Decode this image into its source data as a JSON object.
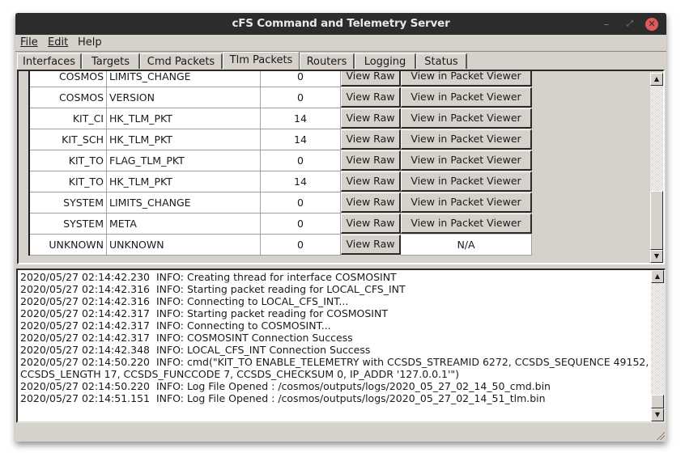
{
  "window": {
    "title": "cFS Command and Telemetry Server",
    "controls": {
      "minimize": "–",
      "maximize": "⤢",
      "close": "✕"
    }
  },
  "menu": [
    "File",
    "Edit",
    "Help"
  ],
  "tabs": [
    {
      "label": "Interfaces",
      "active": false
    },
    {
      "label": "Targets",
      "active": false
    },
    {
      "label": "Cmd Packets",
      "active": false
    },
    {
      "label": "Tlm Packets",
      "active": true
    },
    {
      "label": "Routers",
      "active": false
    },
    {
      "label": "Logging",
      "active": false
    },
    {
      "label": "Status",
      "active": false
    }
  ],
  "tlm_packets": {
    "view_raw_label": "View Raw",
    "view_viewer_label": "View in Packet Viewer",
    "rows": [
      {
        "target": "COSMOS",
        "packet": "LIMITS_CHANGE",
        "count": "0",
        "viewer": "View in Packet Viewer"
      },
      {
        "target": "COSMOS",
        "packet": "VERSION",
        "count": "0",
        "viewer": "View in Packet Viewer"
      },
      {
        "target": "KIT_CI",
        "packet": "HK_TLM_PKT",
        "count": "14",
        "viewer": "View in Packet Viewer"
      },
      {
        "target": "KIT_SCH",
        "packet": "HK_TLM_PKT",
        "count": "14",
        "viewer": "View in Packet Viewer"
      },
      {
        "target": "KIT_TO",
        "packet": "FLAG_TLM_PKT",
        "count": "0",
        "viewer": "View in Packet Viewer"
      },
      {
        "target": "KIT_TO",
        "packet": "HK_TLM_PKT",
        "count": "14",
        "viewer": "View in Packet Viewer"
      },
      {
        "target": "SYSTEM",
        "packet": "LIMITS_CHANGE",
        "count": "0",
        "viewer": "View in Packet Viewer"
      },
      {
        "target": "SYSTEM",
        "packet": "META",
        "count": "0",
        "viewer": "View in Packet Viewer"
      },
      {
        "target": "UNKNOWN",
        "packet": "UNKNOWN",
        "count": "0",
        "viewer": "N/A"
      }
    ]
  },
  "log": [
    "2020/05/27 02:14:42.230  INFO: Creating thread for interface COSMOSINT",
    "2020/05/27 02:14:42.316  INFO: Starting packet reading for LOCAL_CFS_INT",
    "2020/05/27 02:14:42.316  INFO: Connecting to LOCAL_CFS_INT...",
    "2020/05/27 02:14:42.317  INFO: Starting packet reading for COSMOSINT",
    "2020/05/27 02:14:42.317  INFO: Connecting to COSMOSINT...",
    "2020/05/27 02:14:42.317  INFO: COSMOSINT Connection Success",
    "2020/05/27 02:14:42.348  INFO: LOCAL_CFS_INT Connection Success",
    "2020/05/27 02:14:50.220  INFO: cmd(\"KIT_TO ENABLE_TELEMETRY with CCSDS_STREAMID 6272, CCSDS_SEQUENCE 49152, CCSDS_LENGTH 17, CCSDS_FUNCCODE 7, CCSDS_CHECKSUM 0, IP_ADDR '127.0.0.1'\")",
    "2020/05/27 02:14:50.220  INFO: Log File Opened : /cosmos/outputs/logs/2020_05_27_02_14_50_cmd.bin",
    "2020/05/27 02:14:51.151  INFO: Log File Opened : /cosmos/outputs/logs/2020_05_27_02_14_51_tlm.bin"
  ]
}
